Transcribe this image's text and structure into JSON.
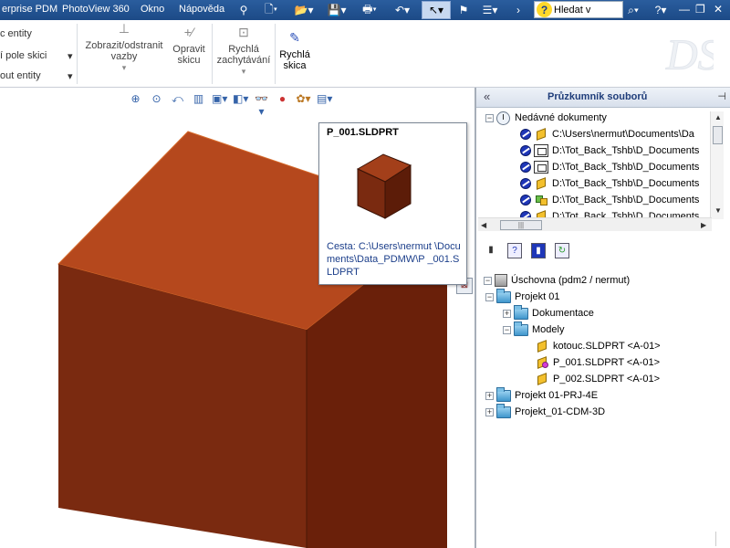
{
  "menubar": {
    "items": [
      "erprise PDM",
      "PhotoView 360",
      "Okno",
      "Nápověda"
    ],
    "search_placeholder": "Hledat v"
  },
  "command_manager": {
    "left_items": [
      "c entity",
      "í pole skici",
      "out entity"
    ],
    "buttons": [
      {
        "label_line1": "Zobrazit/odstranit",
        "label_line2": "vazby"
      },
      {
        "label_line1": "Opravit",
        "label_line2": "skicu"
      },
      {
        "label_line1": "Rychlá",
        "label_line2": "zachytávání"
      },
      {
        "label_line1": "Rychlá",
        "label_line2": "skica"
      }
    ]
  },
  "tooltip": {
    "title": "P_001.SLDPRT",
    "path": "Cesta: C:\\Users\\nermut \\Documents\\Data_PDMW\\P _001.SLDPRT"
  },
  "explorer": {
    "title": "Průzkumník souborů",
    "recent": {
      "label": "Nedávné dokumenty",
      "items": [
        {
          "text": "C:\\Users\\nermut\\Documents\\Da",
          "type": "part"
        },
        {
          "text": "D:\\Tot_Back_Tshb\\D_Documents",
          "type": "drawing"
        },
        {
          "text": "D:\\Tot_Back_Tshb\\D_Documents",
          "type": "drawing"
        },
        {
          "text": "D:\\Tot_Back_Tshb\\D_Documents",
          "type": "part"
        },
        {
          "text": "D:\\Tot_Back_Tshb\\D_Documents",
          "type": "assembly"
        },
        {
          "text": "D:\\Tot_Back_Tshb\\D_Documents",
          "type": "part"
        }
      ]
    },
    "vault": {
      "label": "Úschovna (pdm2 / nermut)",
      "project1": "Projekt 01",
      "dokumentace": "Dokumentace",
      "modely": "Modely",
      "files": [
        "kotouc.SLDPRT <A-01>",
        "P_001.SLDPRT <A-01>",
        "P_002.SLDPRT <A-01>"
      ],
      "projects": [
        "Projekt 01-PRJ-4E",
        "Projekt_01-CDM-3D"
      ]
    }
  },
  "colors": {
    "cube_top": "#b5481d",
    "cube_left": "#7a2a10",
    "cube_right": "#6a200a",
    "menubar": "#2a5d9e"
  }
}
